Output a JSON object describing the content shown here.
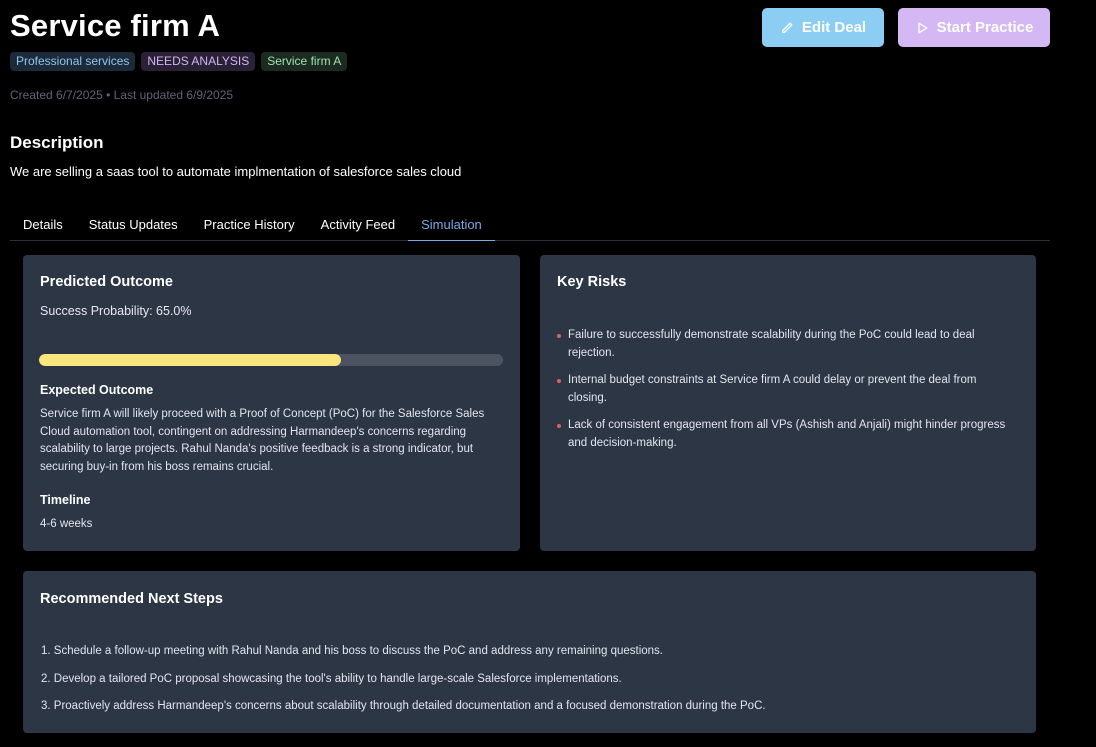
{
  "header": {
    "title": "Service firm A",
    "tags": [
      "Professional services",
      "NEEDS ANALYSIS",
      "Service firm A"
    ],
    "meta": "Created 6/7/2025 • Last updated 6/9/2025",
    "edit_label": "Edit Deal",
    "practice_label": "Start Practice"
  },
  "description": {
    "title": "Description",
    "text": "We are selling a saas tool to automate implmentation of salesforce sales cloud"
  },
  "tabs": [
    "Details",
    "Status Updates",
    "Practice History",
    "Activity Feed",
    "Simulation"
  ],
  "active_tab": "Simulation",
  "outcome": {
    "title": "Predicted Outcome",
    "probability_text": "Success Probability: 65.0%",
    "probability": 0.65,
    "expected_title": "Expected Outcome",
    "expected_text": "Service firm A will likely proceed with a Proof of Concept (PoC) for the Salesforce Sales Cloud automation tool, contingent on addressing Harmandeep's concerns regarding scalability to large projects. Rahul Nanda's positive feedback is a strong indicator, but securing buy-in from his boss remains crucial.",
    "timeline_title": "Timeline",
    "timeline_text": "4-6 weeks"
  },
  "risks": {
    "title": "Key Risks",
    "items": [
      "Failure to successfully demonstrate scalability during the PoC could lead to deal rejection.",
      "Internal budget constraints at Service firm A could delay or prevent the deal from closing.",
      "Lack of consistent engagement from all VPs (Ashish and Anjali) might hinder progress and decision-making."
    ]
  },
  "steps": {
    "title": "Recommended Next Steps",
    "items": [
      "1. Schedule a follow-up meeting with Rahul Nanda and his boss to discuss the PoC and address any remaining questions.",
      "2. Develop a tailored PoC proposal showcasing the tool's ability to handle large-scale Salesforce implementations.",
      "3. Proactively address Harmandeep's concerns about scalability through detailed documentation and a focused demonstration during the PoC."
    ]
  },
  "colors": {
    "background": "#000000",
    "card": "#2d3645",
    "accent_tab": "#7aa8e6",
    "bar_fill": "#f9e77e",
    "risk_bullet": "#e0605e"
  }
}
